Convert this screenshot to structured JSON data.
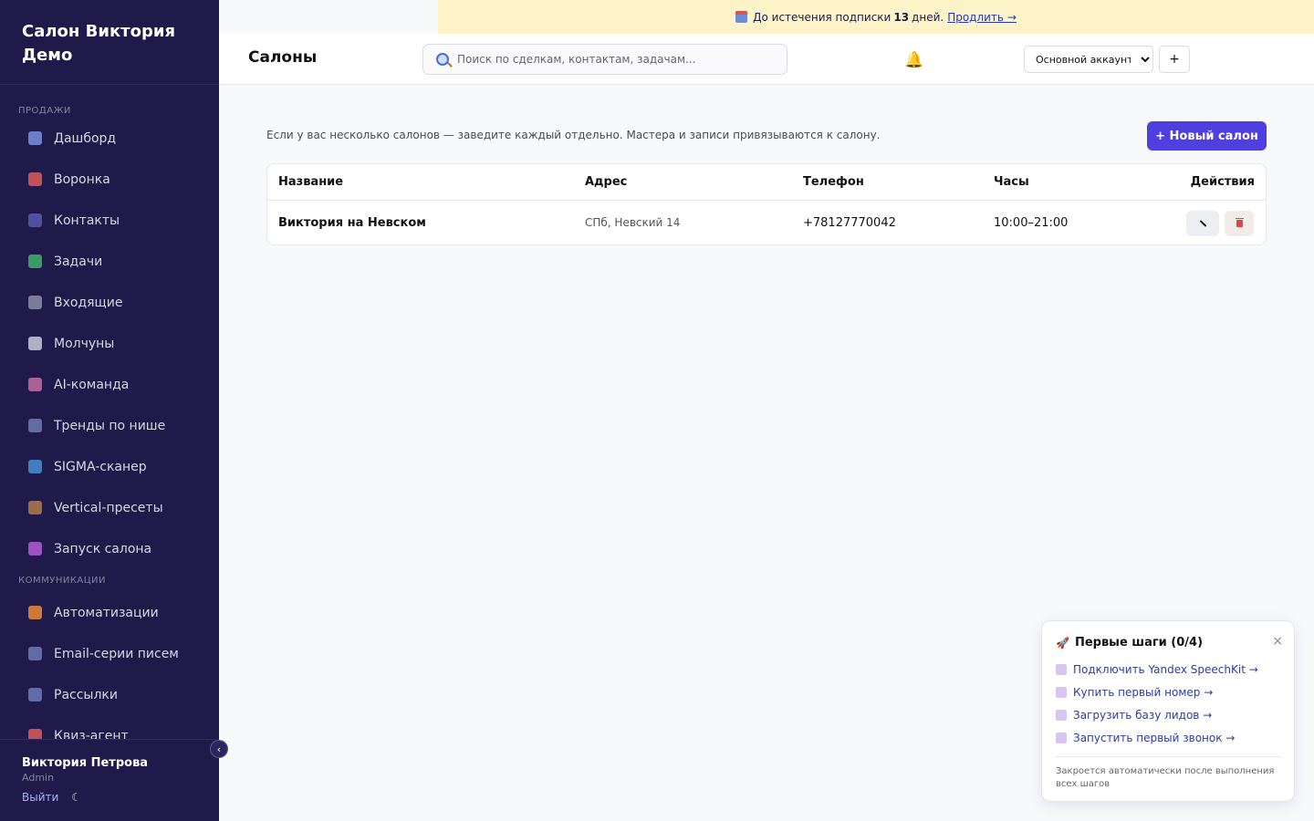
{
  "sidebar": {
    "brand": "Салон Виктория Демо",
    "section_sales": "ПРОДАЖИ",
    "section_comm": "КОММУНИКАЦИИ",
    "items": [
      {
        "label": "Дашборд",
        "icon": "dashboard-icon",
        "color": "#7c8fe0"
      },
      {
        "label": "Воронка",
        "icon": "target-icon",
        "color": "#e05a5a"
      },
      {
        "label": "Контакты",
        "icon": "contacts-icon",
        "color": "#5b5ba8"
      },
      {
        "label": "Задачи",
        "icon": "check-icon",
        "color": "#3fb46a"
      },
      {
        "label": "Входящие",
        "icon": "inbox-icon",
        "color": "#8a8fa8"
      },
      {
        "label": "Молчуны",
        "icon": "speech-bubble-icon",
        "color": "#c9cbd8"
      },
      {
        "label": "AI-команда",
        "icon": "robot-icon",
        "color": "#c46da8"
      },
      {
        "label": "Тренды по нише",
        "icon": "trend-chart-icon",
        "color": "#6d7bb0"
      },
      {
        "label": "SIGMA-сканер",
        "icon": "magnifier-icon",
        "color": "#4a8fd6"
      },
      {
        "label": "Vertical-пресеты",
        "icon": "package-icon",
        "color": "#b07b4a"
      },
      {
        "label": "Запуск салона",
        "icon": "rocket-icon",
        "color": "#b45ad6"
      }
    ],
    "comm_items": [
      {
        "label": "Автоматизации",
        "icon": "lightning-icon",
        "color": "#f08a3a"
      },
      {
        "label": "Email-серии писем",
        "icon": "email-icon",
        "color": "#6f7ab8"
      },
      {
        "label": "Рассылки",
        "icon": "broadcast-icon",
        "color": "#6f7ab8"
      },
      {
        "label": "Квиз-агент",
        "icon": "quiz-icon",
        "color": "#e05a5a"
      }
    ],
    "user_name": "Виктория Петрова",
    "user_role": "Admin",
    "logout": "Выйти",
    "collapse_glyph": "‹",
    "moon_glyph": "☾"
  },
  "banner": {
    "text_before": "До истечения подписки",
    "days": "13",
    "text_after": "дней.",
    "link": "Продлить →"
  },
  "header": {
    "title": "Салоны",
    "search_placeholder": "Поиск по сделкам, контактам, задачам...",
    "account": "Основной аккаунт",
    "plus": "+"
  },
  "main": {
    "intro": "Если у вас несколько салонов — заведите каждый отдельно. Мастера и записи привязываются к салону.",
    "new_button": "+ Новый салон",
    "columns": [
      "Название",
      "Адрес",
      "Телефон",
      "Часы",
      "Действия"
    ],
    "rows": [
      {
        "name": "Виктория на Невском",
        "address": "СПб, Невский 14",
        "phone": "+78127770042",
        "hours": "10:00–21:00"
      }
    ]
  },
  "onboarding": {
    "title": "Первые шаги (0/4)",
    "close": "×",
    "steps": [
      "Подключить Yandex SpeechKit →",
      "Купить первый номер →",
      "Загрузить базу лидов →",
      "Запустить первый звонок →"
    ],
    "note": "Закроется автоматически после выполнения всех шагов"
  }
}
